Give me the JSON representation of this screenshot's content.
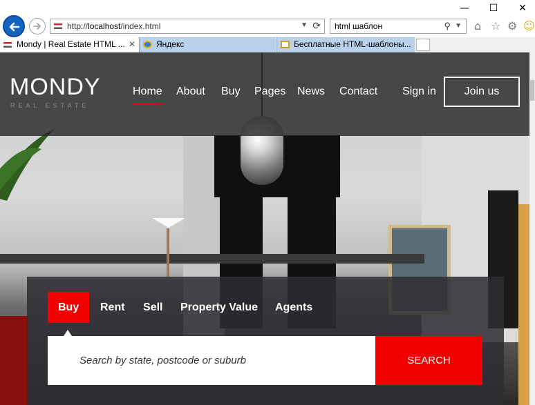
{
  "browser": {
    "window_controls": {
      "minimize": "—",
      "maximize": "☐",
      "close": "✕"
    },
    "address": {
      "prefix": "http://",
      "host": "localhost",
      "path": "/index.html"
    },
    "search_query": "html шаблон",
    "tabs": [
      {
        "label": "Mondy | Real Estate HTML ...",
        "active": true
      },
      {
        "label": "Яндекс",
        "active": false
      },
      {
        "label": "Бесплатные HTML-шаблоны...",
        "active": false
      }
    ],
    "toolbar_icons": [
      "home-icon",
      "star-icon",
      "gear-icon",
      "smiley-icon"
    ]
  },
  "site": {
    "logo": "MONDY",
    "logo_tagline": "REAL ESTATE",
    "nav": [
      {
        "label": "Home",
        "active": true
      },
      {
        "label": "About"
      },
      {
        "label": "Buy"
      },
      {
        "label": "Pages"
      },
      {
        "label": "News"
      },
      {
        "label": "Contact"
      }
    ],
    "sign_in": "Sign in",
    "join": "Join us",
    "accent_color": "#f20000"
  },
  "search": {
    "tabs": [
      "Buy",
      "Rent",
      "Sell",
      "Property Value",
      "Agents"
    ],
    "active_tab": "Buy",
    "placeholder": "Search by state, postcode or suburb",
    "button": "SEARCH"
  }
}
